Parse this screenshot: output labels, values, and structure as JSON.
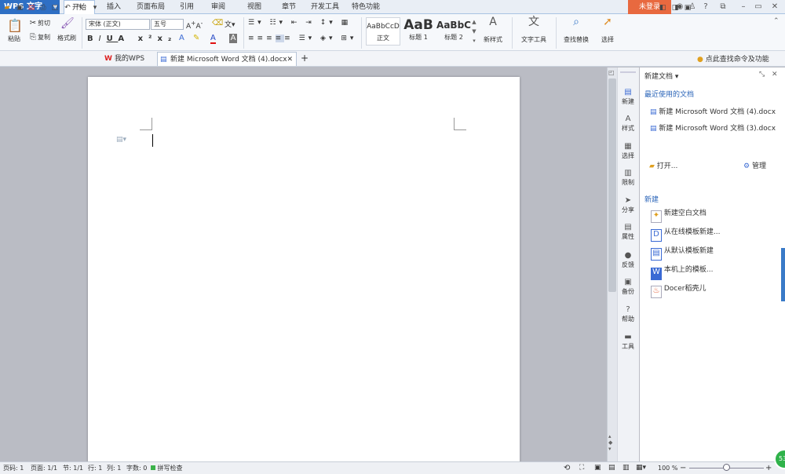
{
  "app": {
    "logo": "WPS 文字"
  },
  "menu_tabs": [
    "开始",
    "插入",
    "页面布局",
    "引用",
    "审阅",
    "视图",
    "章节",
    "开发工具",
    "特色功能"
  ],
  "login": "未登录",
  "ribbon": {
    "paste": "粘贴",
    "cut": "剪切",
    "copy": "复制",
    "format_painter": "格式刷",
    "font_name": "宋体 (正文)",
    "font_size": "五号",
    "styles": [
      {
        "sample": "AaBbCcD",
        "label": "正文"
      },
      {
        "sample": "AaB",
        "label": "标题 1"
      },
      {
        "sample": "AaBbC",
        "label": "标题 2"
      }
    ],
    "new_style": "新样式",
    "text_tools": "文字工具",
    "find_replace": "查找替换",
    "select": "选择"
  },
  "doc_tabs": [
    "我的WPS",
    "新建 Microsoft Word 文档 (4).docx"
  ],
  "find_hint": "点此查找命令及功能",
  "side_tabs": [
    "新建",
    "样式",
    "选择",
    "限制",
    "分享",
    "属性",
    "反馈",
    "备份",
    "帮助",
    "工具"
  ],
  "pane": {
    "title": "新建文档",
    "recent_title": "最近使用的文档",
    "recent": [
      "新建 Microsoft Word 文档 (4).docx",
      "新建 Microsoft Word 文档 (3).docx"
    ],
    "open": "打开...",
    "manage": "管理",
    "new_title": "新建",
    "new_items": [
      "新建空白文档",
      "从在线模板新建...",
      "从默认模板新建",
      "本机上的模板...",
      "Docer稻壳儿"
    ]
  },
  "status": {
    "page_num": "页码: 1",
    "pages": "页面: 1/1",
    "section": "节: 1/1",
    "row": "行: 1",
    "col": "列: 1",
    "words": "字数: 0",
    "spell": "拼写检查",
    "zoom": "100 %"
  },
  "colors": {
    "accent": "#2e6fc4",
    "login": "#e8693f"
  }
}
